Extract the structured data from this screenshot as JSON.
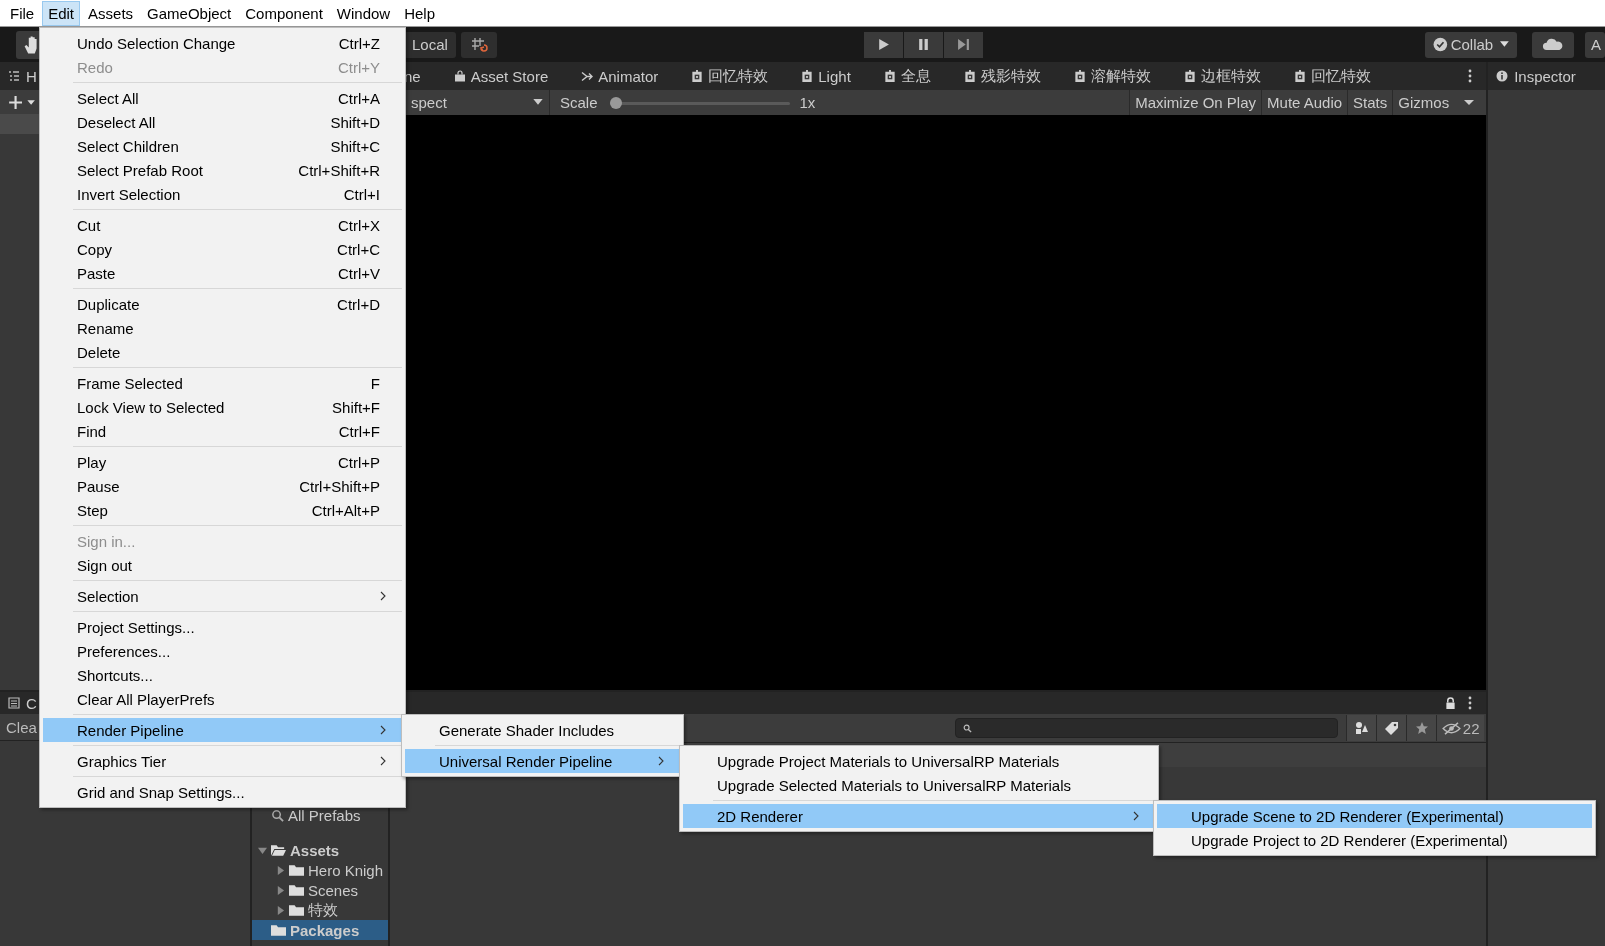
{
  "menu_bar": [
    {
      "label": "File",
      "selected": false
    },
    {
      "label": "Edit",
      "selected": true
    },
    {
      "label": "Assets",
      "selected": false
    },
    {
      "label": "GameObject",
      "selected": false
    },
    {
      "label": "Component",
      "selected": false
    },
    {
      "label": "Window",
      "selected": false
    },
    {
      "label": "Help",
      "selected": false
    }
  ],
  "toolbar": {
    "pivot_button": "Local",
    "collab_button": "Collab",
    "account_button": "A"
  },
  "hierarchy": {
    "tab": "H"
  },
  "game_tabs": [
    {
      "label": "ne",
      "kind": "plain"
    },
    {
      "label": "Asset Store",
      "kind": "store"
    },
    {
      "label": "Animator",
      "kind": "animator"
    },
    {
      "label": "回忆特效",
      "kind": "prefab"
    },
    {
      "label": "Light",
      "kind": "prefab"
    },
    {
      "label": "全息",
      "kind": "prefab"
    },
    {
      "label": "残影特效",
      "kind": "prefab"
    },
    {
      "label": "溶解特效",
      "kind": "prefab"
    },
    {
      "label": "边框特效",
      "kind": "prefab"
    },
    {
      "label": "回忆特效",
      "kind": "prefab"
    }
  ],
  "game_toolbar": {
    "aspect": "spect",
    "scale_label": "Scale",
    "scale": {
      "level": 0
    },
    "scale_value": "1x",
    "buttons": [
      "Maximize On Play",
      "Mute Audio",
      "Stats",
      "Gizmos"
    ]
  },
  "inspector": {
    "tab": "Inspector"
  },
  "console": {
    "tab": "C",
    "clear_button": "Clea"
  },
  "project": {
    "hidden_count": "22",
    "tree": [
      {
        "label": "All Prefabs",
        "kind": "search",
        "selected": false
      },
      {
        "label": "Assets",
        "kind": "folder",
        "expanded": true,
        "selected": false,
        "children": [
          {
            "label": "Hero Knigh",
            "kind": "folder",
            "expanded": false,
            "selected": false
          },
          {
            "label": "Scenes",
            "kind": "folder",
            "expanded": false,
            "selected": false
          },
          {
            "label": "特效",
            "kind": "folder",
            "expanded": false,
            "selected": false
          }
        ]
      },
      {
        "label": "Packages",
        "kind": "folder",
        "selected": true
      }
    ]
  },
  "edit_menu": {
    "groups": [
      [
        {
          "label": "Undo Selection Change",
          "shortcut": "Ctrl+Z",
          "disabled": false,
          "selected": false
        },
        {
          "label": "Redo",
          "shortcut": "Ctrl+Y",
          "disabled": true,
          "selected": false
        }
      ],
      [
        {
          "label": "Select All",
          "shortcut": "Ctrl+A",
          "disabled": false,
          "selected": false
        },
        {
          "label": "Deselect All",
          "shortcut": "Shift+D",
          "disabled": false,
          "selected": false
        },
        {
          "label": "Select Children",
          "shortcut": "Shift+C",
          "disabled": false,
          "selected": false
        },
        {
          "label": "Select Prefab Root",
          "shortcut": "Ctrl+Shift+R",
          "disabled": false,
          "selected": false
        },
        {
          "label": "Invert Selection",
          "shortcut": "Ctrl+I",
          "disabled": false,
          "selected": false
        }
      ],
      [
        {
          "label": "Cut",
          "shortcut": "Ctrl+X",
          "disabled": false,
          "selected": false
        },
        {
          "label": "Copy",
          "shortcut": "Ctrl+C",
          "disabled": false,
          "selected": false
        },
        {
          "label": "Paste",
          "shortcut": "Ctrl+V",
          "disabled": false,
          "selected": false
        }
      ],
      [
        {
          "label": "Duplicate",
          "shortcut": "Ctrl+D",
          "disabled": false,
          "selected": false
        },
        {
          "label": "Rename",
          "disabled": false,
          "selected": false
        },
        {
          "label": "Delete",
          "disabled": false,
          "selected": false
        }
      ],
      [
        {
          "label": "Frame Selected",
          "shortcut": "F",
          "disabled": false,
          "selected": false
        },
        {
          "label": "Lock View to Selected",
          "shortcut": "Shift+F",
          "disabled": false,
          "selected": false
        },
        {
          "label": "Find",
          "shortcut": "Ctrl+F",
          "disabled": false,
          "selected": false
        }
      ],
      [
        {
          "label": "Play",
          "shortcut": "Ctrl+P",
          "disabled": false,
          "selected": false
        },
        {
          "label": "Pause",
          "shortcut": "Ctrl+Shift+P",
          "disabled": false,
          "selected": false
        },
        {
          "label": "Step",
          "shortcut": "Ctrl+Alt+P",
          "disabled": false,
          "selected": false
        }
      ],
      [
        {
          "label": "Sign in...",
          "disabled": true,
          "selected": false
        },
        {
          "label": "Sign out",
          "disabled": false,
          "selected": false
        }
      ],
      [
        {
          "label": "Selection",
          "submenu": true,
          "disabled": false,
          "selected": false
        }
      ],
      [
        {
          "label": "Project Settings...",
          "disabled": false,
          "selected": false
        },
        {
          "label": "Preferences...",
          "disabled": false,
          "selected": false
        },
        {
          "label": "Shortcuts...",
          "disabled": false,
          "selected": false
        },
        {
          "label": "Clear All PlayerPrefs",
          "disabled": false,
          "selected": false
        }
      ],
      [
        {
          "label": "Render Pipeline",
          "submenu": true,
          "disabled": false,
          "selected": true
        }
      ],
      [
        {
          "label": "Graphics Tier",
          "submenu": true,
          "disabled": false,
          "selected": false
        }
      ],
      [
        {
          "label": "Grid and Snap Settings...",
          "disabled": false,
          "selected": false
        }
      ]
    ]
  },
  "submenus": [
    {
      "groups": [
        [
          {
            "label": "Generate Shader Includes",
            "selected": false
          }
        ],
        [
          {
            "label": "Universal Render Pipeline",
            "submenu": true,
            "selected": true
          }
        ]
      ]
    },
    {
      "groups": [
        [
          {
            "label": "Upgrade Project Materials to UniversalRP Materials",
            "selected": false
          },
          {
            "label": "Upgrade Selected Materials to UniversalRP Materials",
            "selected": false
          }
        ],
        [
          {
            "label": "2D Renderer",
            "submenu": true,
            "selected": true
          }
        ]
      ]
    },
    {
      "groups": [
        [
          {
            "label": "Upgrade Scene to 2D Renderer (Experimental)",
            "selected": true
          },
          {
            "label": "Upgrade Project to 2D Renderer (Experimental)",
            "selected": false
          }
        ]
      ]
    }
  ]
}
